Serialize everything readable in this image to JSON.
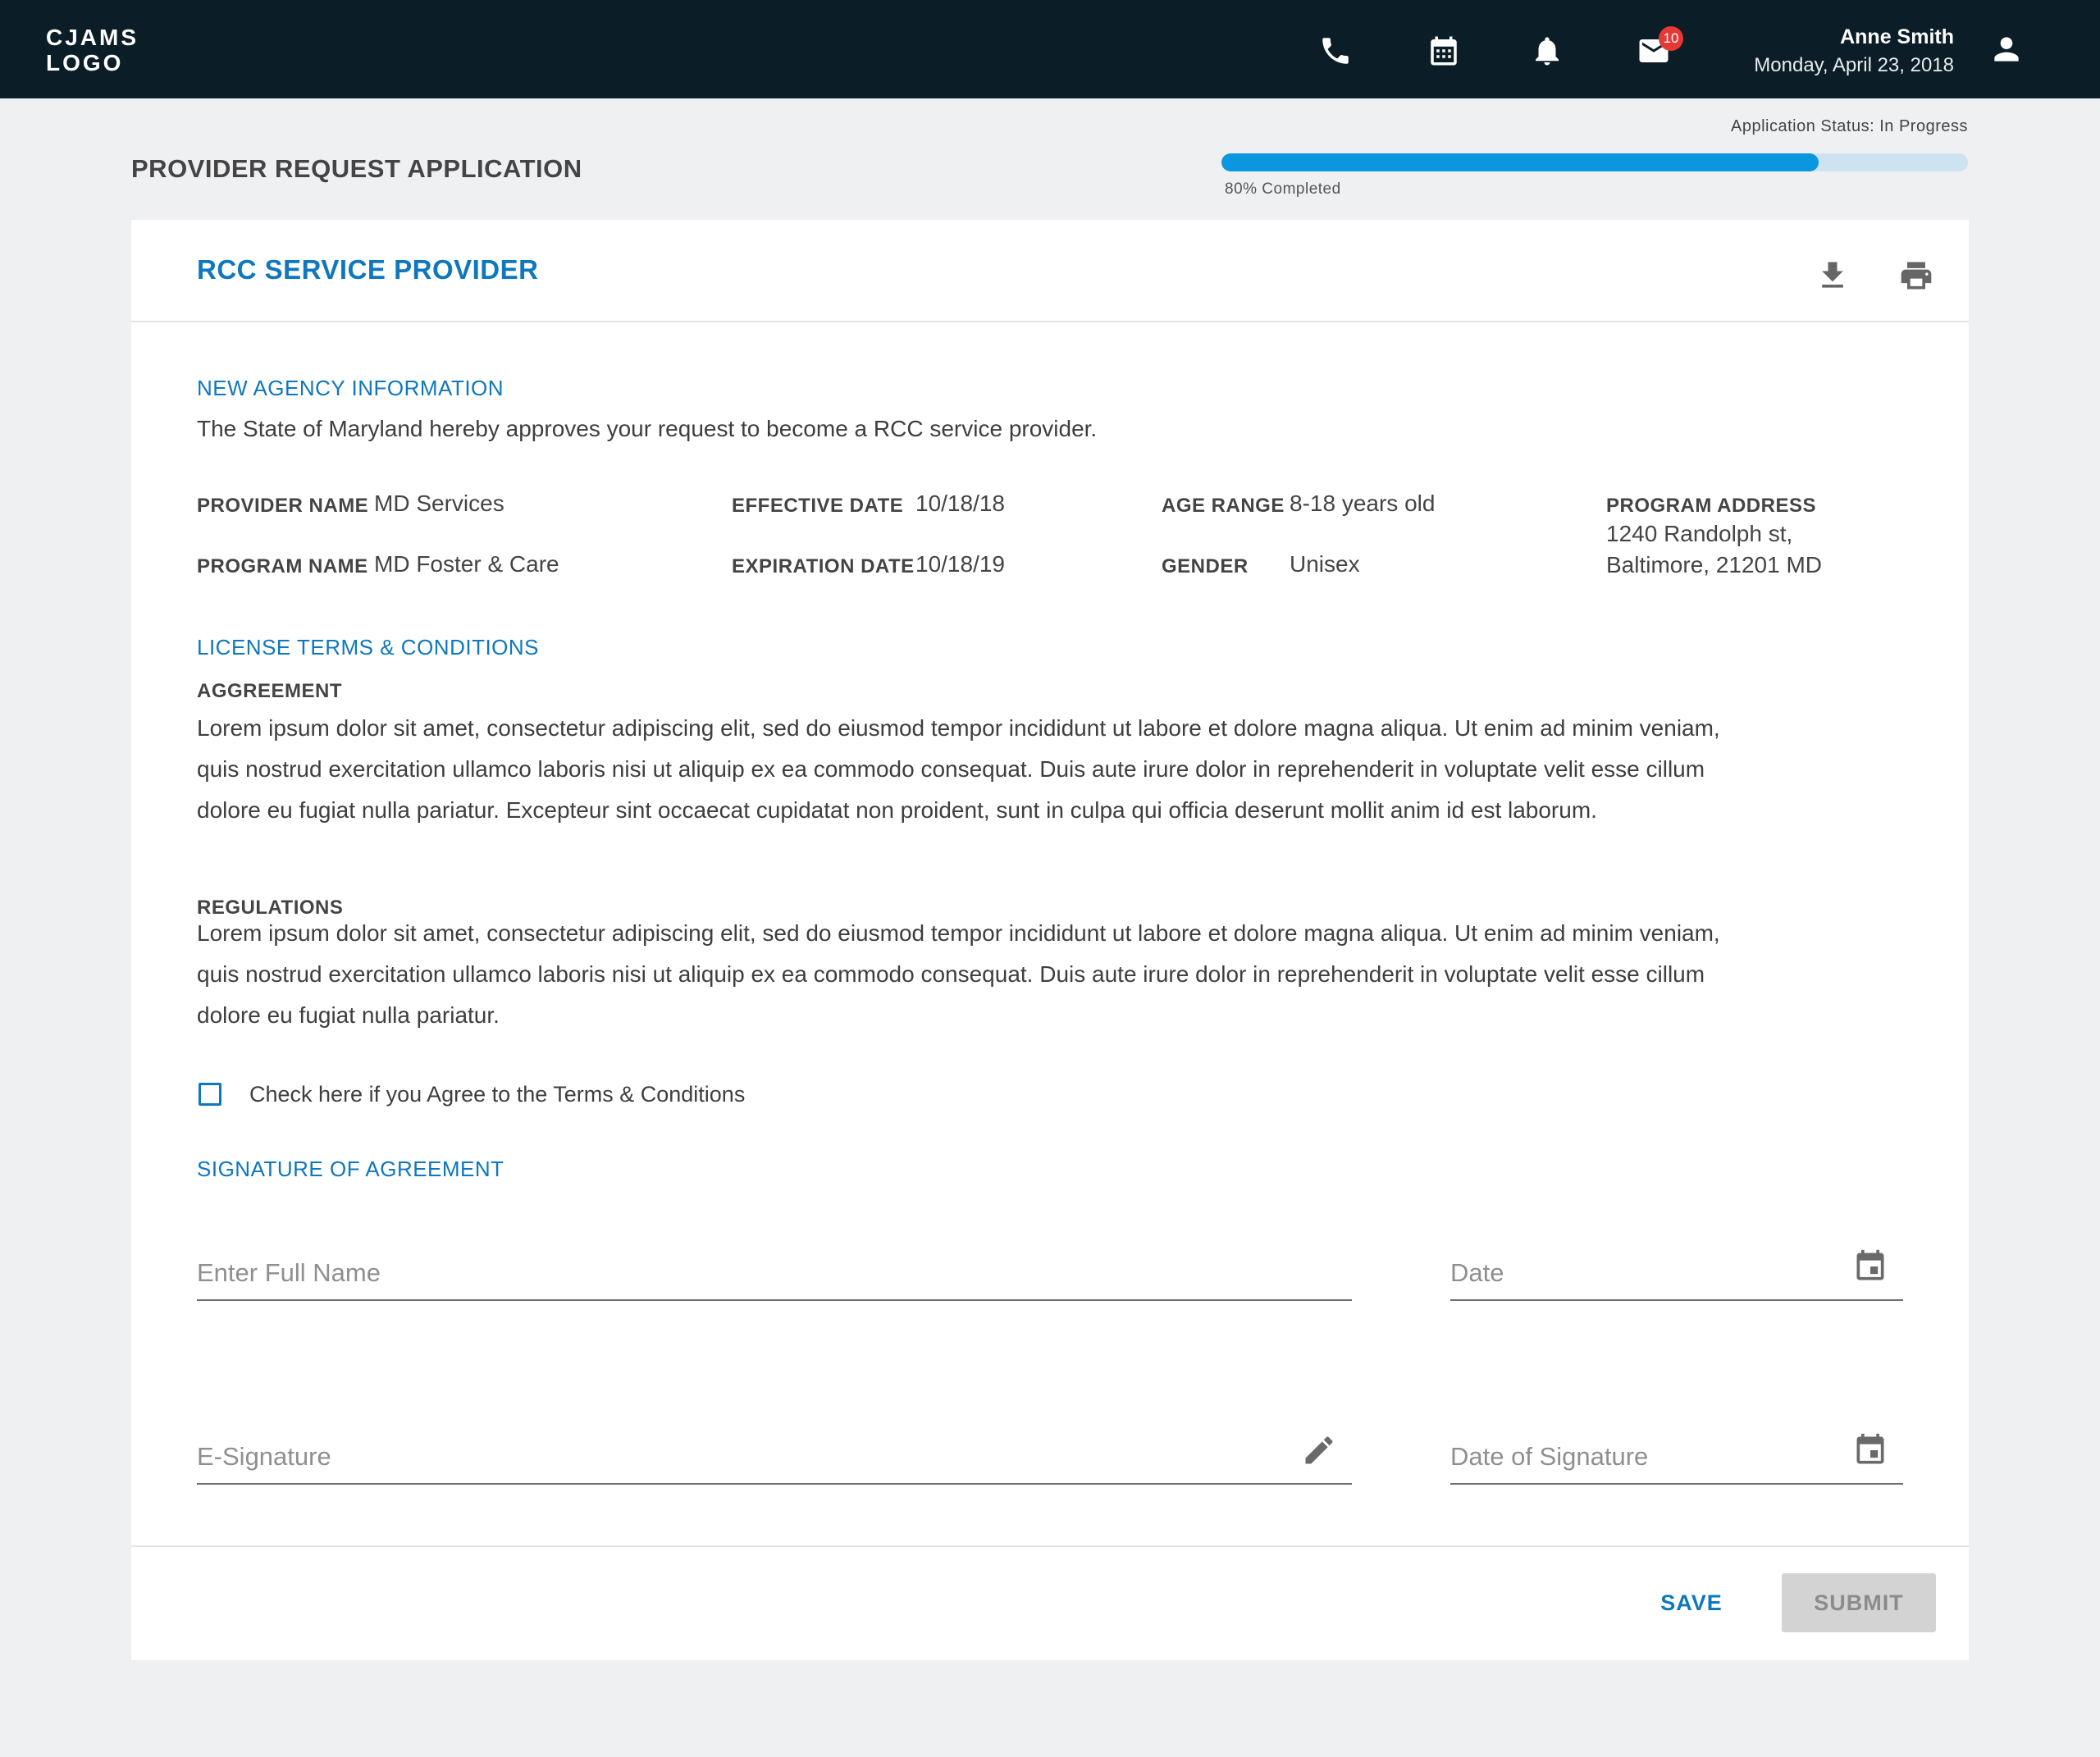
{
  "header": {
    "logo_line1": "CJAMS",
    "logo_line2": "LOGO",
    "mail_count": "10",
    "user_name": "Anne Smith",
    "user_date": "Monday, April 23, 2018",
    "icons": [
      "phone-icon",
      "calendar-icon",
      "bell-icon",
      "mail-icon",
      "account-icon"
    ]
  },
  "page": {
    "title": "PROVIDER REQUEST APPLICATION",
    "status": "Application Status: In Progress",
    "progress_percent": 80,
    "progress_label": "80% Completed"
  },
  "card": {
    "title": "RCC SERVICE PROVIDER",
    "actions": [
      "download-icon",
      "print-icon"
    ]
  },
  "agency": {
    "heading": "NEW AGENCY INFORMATION",
    "intro": "The State of Maryland hereby approves your request to become a RCC service provider.",
    "provider_name_label": "PROVIDER NAME",
    "provider_name": "MD Services",
    "program_name_label": "PROGRAM NAME",
    "program_name": "MD Foster & Care",
    "effective_date_label": "EFFECTIVE DATE",
    "effective_date": "10/18/18",
    "expiration_date_label": "EXPIRATION DATE",
    "expiration_date": "10/18/19",
    "age_range_label": "AGE RANGE",
    "age_range": "8-18 years old",
    "gender_label": "GENDER",
    "gender": "Unisex",
    "program_address_label": "PROGRAM ADDRESS",
    "program_address_line1": "1240 Randolph st,",
    "program_address_line2": "Baltimore, 21201 MD"
  },
  "license": {
    "heading": "LICENSE TERMS & CONDITIONS",
    "agreement_label": "AGGREEMENT",
    "agreement_lines": [
      "Lorem ipsum dolor sit amet, consectetur adipiscing elit, sed do eiusmod tempor incididunt ut labore et dolore magna aliqua. Ut enim ad minim veniam,",
      "quis nostrud exercitation ullamco laboris nisi ut aliquip ex ea commodo consequat. Duis aute irure dolor in reprehenderit in voluptate velit esse cillum",
      "dolore eu fugiat nulla pariatur. Excepteur sint occaecat cupidatat non proident, sunt in culpa qui officia deserunt mollit anim id est laborum."
    ],
    "regulations_label": "REGULATIONS",
    "regulations_lines": [
      "Lorem ipsum dolor sit amet, consectetur adipiscing elit, sed do eiusmod tempor incididunt ut labore et dolore magna aliqua. Ut enim ad minim veniam,",
      "quis nostrud exercitation ullamco laboris nisi ut aliquip ex ea commodo consequat. Duis aute irure dolor in reprehenderit in voluptate velit esse cillum",
      "dolore eu fugiat nulla pariatur."
    ],
    "agree_checkbox_label": "Check here if you Agree to the Terms & Conditions",
    "agree_checked": false
  },
  "signature": {
    "heading": "SIGNATURE OF AGREEMENT",
    "full_name_placeholder": "Enter Full Name",
    "full_name_value": "",
    "date_placeholder": "Date",
    "date_value": "",
    "esignature_placeholder": "E-Signature",
    "esignature_value": "",
    "date_of_signature_placeholder": "Date of Signature",
    "date_of_signature_value": "",
    "field_icons": [
      "calendar-icon",
      "pencil-icon",
      "calendar-icon"
    ]
  },
  "footer": {
    "save_label": "SAVE",
    "submit_label": "SUBMIT"
  },
  "colors": {
    "topbar": "#0b1e27",
    "accent": "#0f77bd",
    "progress_fill": "#0b97e0",
    "progress_track": "#cde3f2",
    "badge": "#e53935",
    "page_bg": "#eff0f2",
    "submit_disabled": "#d3d3d3"
  }
}
